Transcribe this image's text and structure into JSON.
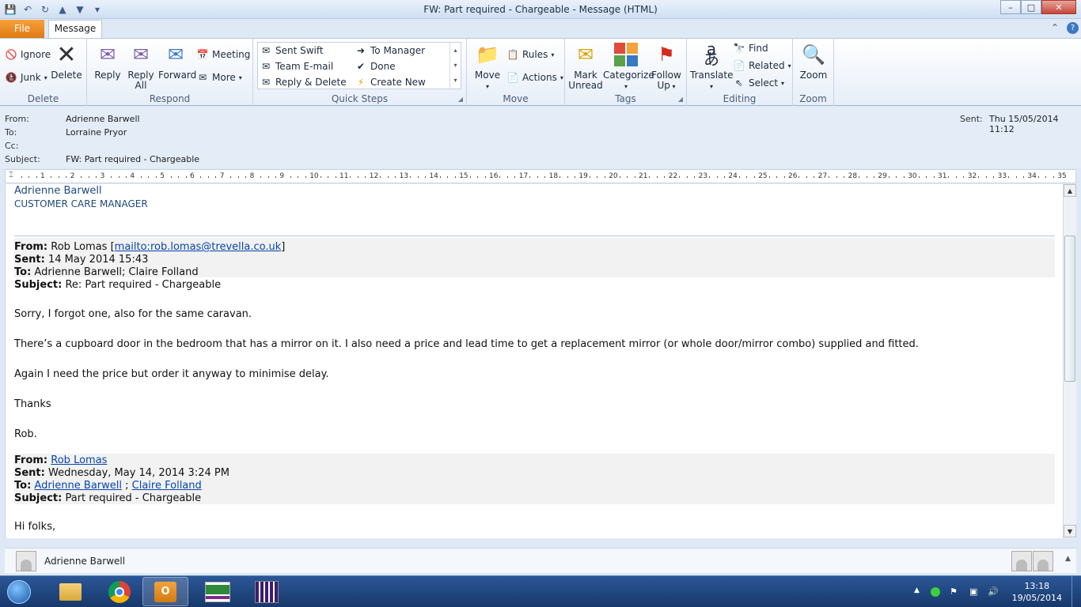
{
  "window": {
    "title": "FW: Part required - Chargeable  -  Message (HTML)",
    "controls": {
      "minimize": "–",
      "maximize": "□",
      "close": "✕"
    }
  },
  "tabs": {
    "file": "File",
    "message": "Message"
  },
  "ribbon": {
    "delete_group": {
      "label": "Delete",
      "ignore": "Ignore",
      "junk": "Junk",
      "delete": "Delete"
    },
    "respond_group": {
      "label": "Respond",
      "reply": "Reply",
      "reply_all_1": "Reply",
      "reply_all_2": "All",
      "forward": "Forward",
      "meeting": "Meeting",
      "more": "More"
    },
    "quicksteps_group": {
      "label": "Quick Steps",
      "items": [
        "Sent Swift",
        "Team E-mail",
        "Reply & Delete",
        "To Manager",
        "Done",
        "Create New"
      ]
    },
    "move_group": {
      "label": "Move",
      "move": "Move",
      "rules": "Rules",
      "actions": "Actions"
    },
    "tags_group": {
      "label": "Tags",
      "mark_unread_1": "Mark",
      "mark_unread_2": "Unread",
      "categorize": "Categorize",
      "follow_up_1": "Follow",
      "follow_up_2": "Up"
    },
    "editing_group": {
      "label": "Editing",
      "translate": "Translate",
      "find": "Find",
      "related": "Related",
      "select": "Select"
    },
    "zoom_group": {
      "label": "Zoom",
      "zoom": "Zoom"
    }
  },
  "header": {
    "from_label": "From:",
    "from": "Adrienne Barwell",
    "to_label": "To:",
    "to": "Lorraine Pryor",
    "cc_label": "Cc:",
    "subject_label": "Subject:",
    "subject": "FW: Part required - Chargeable",
    "sent_label": "Sent:",
    "sent": "Thu 15/05/2014 11:12"
  },
  "ruler": {
    "ticks": [
      "1",
      "2",
      "3",
      "4",
      "5",
      "6",
      "7",
      "8",
      "9",
      "10",
      "11",
      "12",
      "13",
      "14",
      "15",
      "16",
      "17",
      "18",
      "19",
      "20",
      "21",
      "22",
      "23",
      "24",
      "25",
      "26",
      "27",
      "28",
      "29",
      "30",
      "31",
      "32",
      "33",
      "34",
      "35"
    ]
  },
  "body": {
    "sig_name": "Adrienne Barwell",
    "sig_title": "CUSTOMER CARE MANAGER",
    "fwd1": {
      "from_label": "From:",
      "from_name": "Rob Lomas ",
      "from_bracket_open": "[",
      "from_link": "mailto:rob.lomas@trevella.co.uk",
      "from_bracket_close": "]",
      "sent_label": "Sent:",
      "sent": "14 May 2014 15:43",
      "to_label": "To:",
      "to": "Adrienne Barwell; Claire Folland",
      "subject_label": "Subject:",
      "subject": "Re: Part required - Chargeable"
    },
    "paragraphs": [
      "Sorry, I forgot one, also for the same caravan.",
      "There’s a cupboard door in the bedroom that has a mirror on it. I also need a price and lead time to get a replacement mirror (or whole door/mirror combo) supplied and fitted.",
      "Again I need the price but order it anyway to minimise delay.",
      "Thanks",
      "Rob."
    ],
    "fwd2": {
      "from_label": "From:",
      "from_link": "Rob Lomas",
      "sent_label": "Sent:",
      "sent": "Wednesday, May 14, 2014 3:24 PM",
      "to_label": "To:",
      "to_link1": "Adrienne Barwell",
      "to_sep": " ; ",
      "to_link2": "Claire Folland",
      "subject_label": "Subject:",
      "subject": "Part required - Chargeable"
    },
    "greeting": "Hi folks,"
  },
  "people_pane": {
    "name": "Adrienne Barwell"
  },
  "taskbar": {
    "time": "13:18",
    "date": "19/05/2014"
  }
}
